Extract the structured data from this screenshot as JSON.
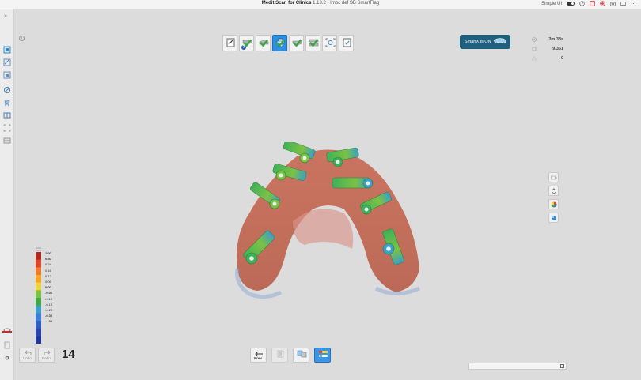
{
  "window": {
    "app_name": "Medit Scan for Clinics",
    "version_text": "1.13.2 - Impc def SB SmartFlag",
    "simple_ui_label": "Simple UI"
  },
  "top_stages": [
    {
      "name": "prescription",
      "icon": "pencil-form-icon",
      "checked": false,
      "active": false
    },
    {
      "name": "maxilla",
      "icon": "upper-jaw-icon",
      "checked": false,
      "active": false,
      "help": "?"
    },
    {
      "name": "mandible",
      "icon": "lower-jaw-icon",
      "checked": true,
      "active": false
    },
    {
      "name": "scanbody",
      "icon": "scanbody-icon",
      "checked": true,
      "active": true
    },
    {
      "name": "maxilla-2",
      "icon": "upper-jaw-icon",
      "checked": true,
      "active": false
    },
    {
      "name": "occlusion",
      "icon": "occlusion-icon",
      "checked": true,
      "active": false
    },
    {
      "name": "align",
      "icon": "align-icon",
      "checked": false,
      "active": false
    },
    {
      "name": "complete",
      "icon": "checklist-icon",
      "checked": false,
      "active": false
    }
  ],
  "smartx": {
    "label": "SmartX is ON"
  },
  "stats": {
    "time": "3m 38s",
    "data_count": "9.361",
    "issues": "0"
  },
  "legend": {
    "values": [
      "1.00",
      "0.30",
      "0.24",
      "0.18",
      "0.12",
      "0.06",
      "0.00",
      "-0.06",
      "-0.12",
      "-0.18",
      "-0.24",
      "-0.30",
      "-1.00"
    ],
    "colors": [
      "#b3261e",
      "#e0452b",
      "#f07a2a",
      "#f5a623",
      "#f0d33a",
      "#7cc243",
      "#3fa845",
      "#3aa0c8",
      "#3b7fd6",
      "#2f5fc4",
      "#2a45b0",
      "#243599"
    ]
  },
  "bottom": {
    "undo_label": "Undo",
    "redo_label": "Redo",
    "step_number": "14",
    "prev_label": "Prev."
  }
}
